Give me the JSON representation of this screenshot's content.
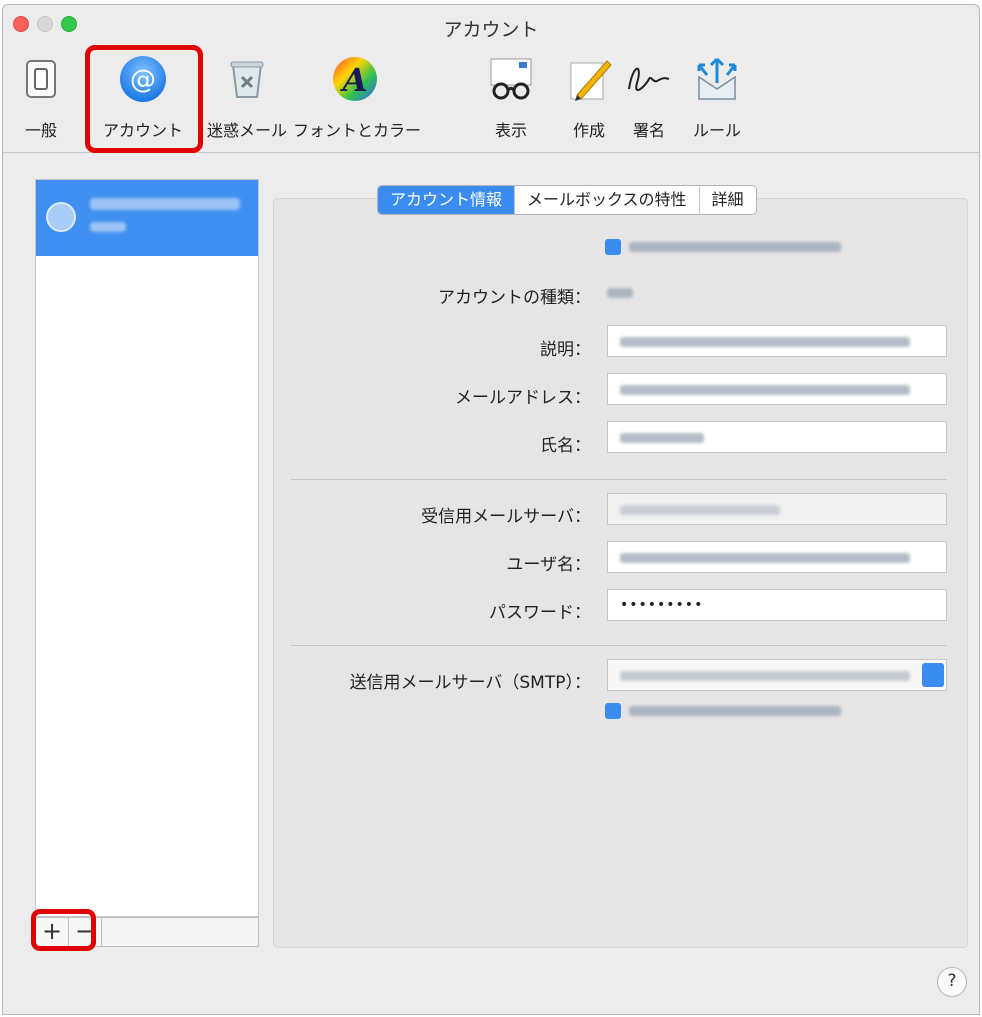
{
  "window": {
    "title": "アカウント"
  },
  "toolbar": {
    "items": [
      {
        "label": "一般",
        "icon": "switch-icon"
      },
      {
        "label": "アカウント",
        "icon": "at-sign-icon"
      },
      {
        "label": "迷惑メール",
        "icon": "junk-trash-icon"
      },
      {
        "label": "フォントとカラー",
        "icon": "font-color-icon"
      },
      {
        "label": "表示",
        "icon": "glasses-icon"
      },
      {
        "label": "作成",
        "icon": "pencil-icon"
      },
      {
        "label": "署名",
        "icon": "signature-icon"
      },
      {
        "label": "ルール",
        "icon": "rules-envelope-icon"
      }
    ]
  },
  "sidebar": {
    "account": {
      "name": "cpuborl…",
      "type": "POP"
    },
    "add_label": "+",
    "remove_label": "−"
  },
  "tabs": [
    {
      "label": "アカウント情報",
      "active": true
    },
    {
      "label": "メールボックスの特性",
      "active": false
    },
    {
      "label": "詳細",
      "active": false
    }
  ],
  "form": {
    "enable_account_label": "このアカウントを使用",
    "account_type_label": "アカウントの種類：",
    "account_type_value": "POP",
    "description_label": "説明：",
    "email_label": "メールアドレス：",
    "fullname_label": "氏名：",
    "fullname_value": "User Name",
    "incoming_label": "受信用メールサーバ：",
    "username_label": "ユーザ名：",
    "password_label": "パスワード：",
    "password_value": "•••••••••",
    "smtp_label": "送信用メールサーバ（SMTP）：",
    "smtp_only_label": "このサーバのみを使用"
  },
  "help_label": "?",
  "colors": {
    "accent": "#3b8cf0",
    "highlight_red": "#e00000"
  }
}
